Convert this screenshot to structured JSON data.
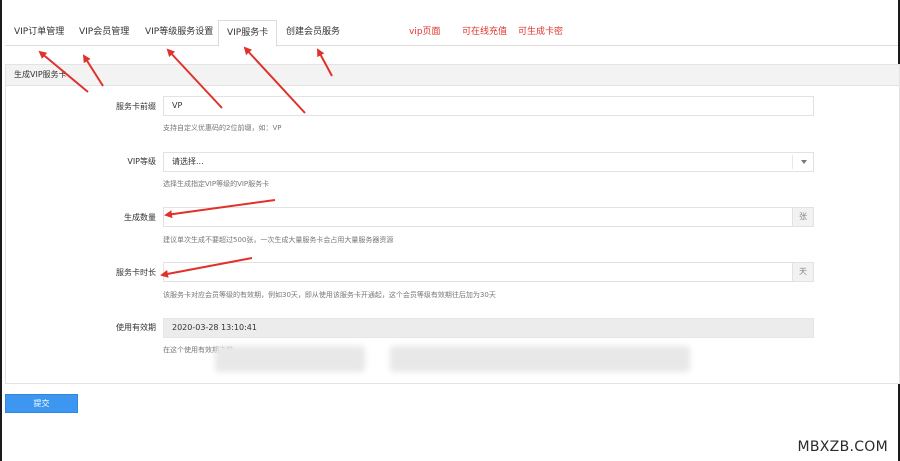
{
  "tabs": [
    {
      "label": "VIP订单管理",
      "active": false
    },
    {
      "label": "VIP会员管理",
      "active": false
    },
    {
      "label": "VIP等级服务设置",
      "active": false
    },
    {
      "label": "VIP服务卡",
      "active": true
    },
    {
      "label": "创建会员服务",
      "active": false
    }
  ],
  "annotations": {
    "vip_page": "vip页面",
    "online_recharge": "可在线充值",
    "generate_card": "可生成卡密"
  },
  "panel": {
    "heading": "生成VIP服务卡"
  },
  "form": {
    "prefix": {
      "label": "服务卡前缀",
      "value": "VP",
      "help": "支持自定义优惠码的2位前缀，如：VP"
    },
    "level": {
      "label": "VIP等级",
      "placeholder": "请选择...",
      "help": "选择生成指定VIP等级的VIP服务卡"
    },
    "quantity": {
      "label": "生成数量",
      "value": "",
      "unit": "张",
      "help": "建议单次生成不要超过500张，一次生成大量服务卡会占用大量服务器资源"
    },
    "duration": {
      "label": "服务卡时长",
      "value": "",
      "unit": "天",
      "help": "该服务卡对应会员等级的有效期，例如30天，即从使用该服务卡开通起，这个会员等级有效期往后加为30天"
    },
    "expiry": {
      "label": "使用有效期",
      "value": "2020-03-28 13:10:41",
      "help": "在这个使用有效期之前"
    }
  },
  "submit_label": "提交",
  "watermark": "MBXZB.COM",
  "colors": {
    "accent": "#3d97f0",
    "annotation": "#e0312a"
  }
}
